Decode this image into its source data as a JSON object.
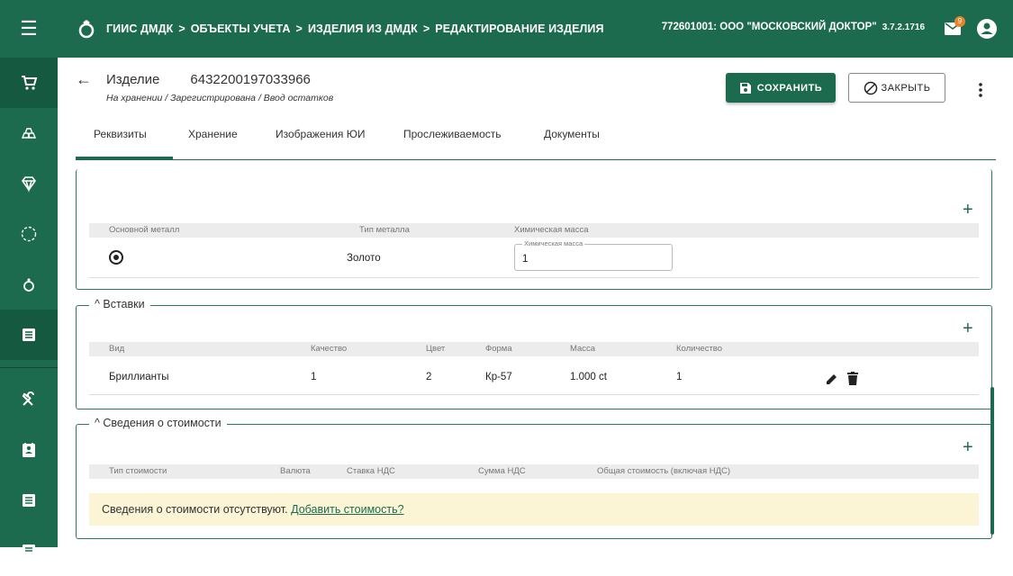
{
  "topbar": {
    "breadcrumbs": [
      "ГИИС ДМДК",
      "ОБЪЕКТЫ УЧЕТА",
      "ИЗДЕЛИЯ ИЗ ДМДК",
      "РЕДАКТИРОВАНИЕ ИЗДЕЛИЯ"
    ],
    "separator": ">",
    "organization": "772601001: ООО \"МОСКОВСКИЙ ДОКТОР\"",
    "version": "3.7.2.1716",
    "mail_badge": "9"
  },
  "item": {
    "label": "Изделие",
    "number": "6432200197033966",
    "status": "На хранении / Зарегистрирована / Ввод остатков"
  },
  "actions": {
    "save_label": "СОХРАНИТЬ",
    "close_label": "ЗАКРЫТЬ"
  },
  "tabs": [
    "Реквизиты",
    "Хранение",
    "Изображения ЮИ",
    "Прослеживаемость",
    "Документы"
  ],
  "metals": {
    "headers": [
      "Основной металл",
      "Тип металла",
      "Химическая масса"
    ],
    "rows": [
      {
        "metal_type": "Золото",
        "mass_label": "Химическая масса",
        "mass_value": "1"
      }
    ]
  },
  "inserts": {
    "title": "Вставки",
    "headers": [
      "Вид",
      "Качество",
      "Цвет",
      "Форма",
      "Масса",
      "Количество"
    ],
    "rows": [
      {
        "kind": "Бриллианты",
        "quality": "1",
        "color": "2",
        "shape": "Кр-57",
        "mass": "1.000 ct",
        "quantity": "1"
      }
    ]
  },
  "cost": {
    "title": "Сведения о стоимости",
    "headers": [
      "Тип стоимости",
      "Валюта",
      "Ставка НДС",
      "Сумма НДС",
      "Общая стоимость (включая НДС)"
    ],
    "empty_text": "Сведения о стоимости отсутствуют.",
    "add_link": "Добавить стоимость?"
  },
  "icons": {
    "menu": "menu-icon",
    "plus": "+",
    "collapse": "^"
  },
  "colors": {
    "brand": "#1d6b4e",
    "notice_bg": "#fbf5d6",
    "badge": "#e8822b"
  }
}
